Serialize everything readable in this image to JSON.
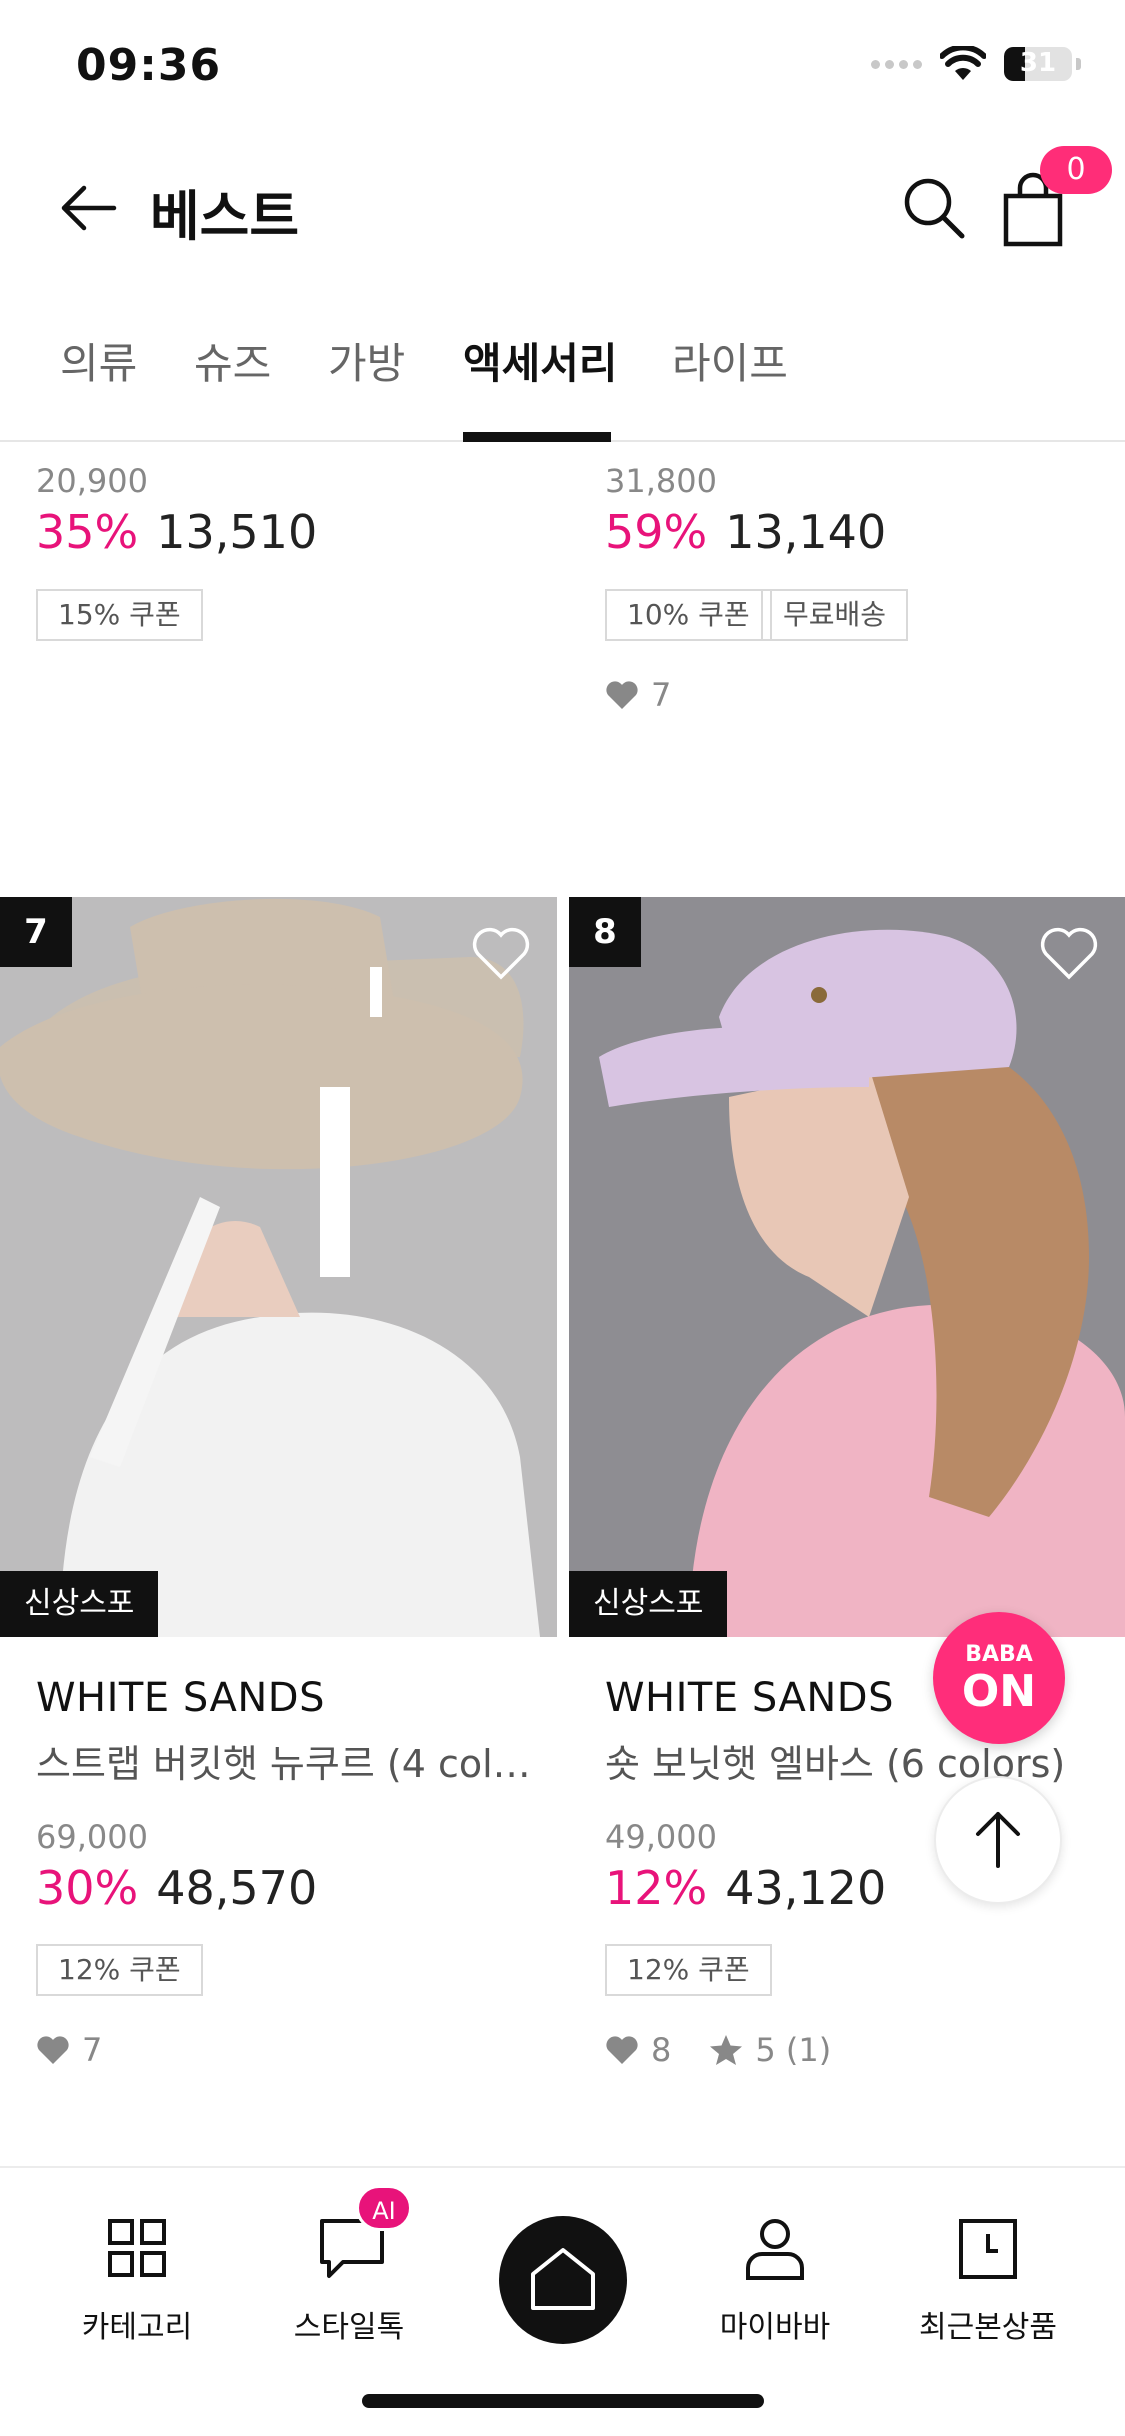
{
  "status_bar": {
    "time": "09:36",
    "battery": "31",
    "battery_level": 0.31
  },
  "header": {
    "title": "베스트",
    "cart_count": "0"
  },
  "tabs": [
    {
      "label": "의류",
      "active": false
    },
    {
      "label": "슈즈",
      "active": false
    },
    {
      "label": "가방",
      "active": false
    },
    {
      "label": "액세서리",
      "active": true
    },
    {
      "label": "라이프",
      "active": false
    }
  ],
  "prev_products": [
    {
      "original_price": "20,900",
      "discount": "35%",
      "price": "13,510",
      "chips": [
        "15% 쿠폰"
      ],
      "likes": null
    },
    {
      "original_price": "31,800",
      "discount": "59%",
      "price": "13,140",
      "chips": [
        "10% 쿠폰",
        "무료배송"
      ],
      "likes": "7"
    }
  ],
  "products": [
    {
      "rank": "7",
      "badge": "신상스포",
      "brand": "WHITE SANDS",
      "name": "스트랩 버킷햇 뉴쿠르 (4 color...",
      "original_price": "69,000",
      "discount": "30%",
      "price": "48,570",
      "chips": [
        "12% 쿠폰"
      ],
      "likes": "7",
      "rating": null,
      "image_colors": {
        "bg": "#bdbcbd",
        "hat": "#cdbfae",
        "shirt": "#f2f2f2",
        "skin": "#e9cdbf"
      }
    },
    {
      "rank": "8",
      "badge": "신상스포",
      "brand": "WHITE SANDS",
      "name": "숏 보닛햇 엘바스 (6 colors)",
      "original_price": "49,000",
      "discount": "12%",
      "price": "43,120",
      "chips": [
        "12% 쿠폰"
      ],
      "likes": "8",
      "rating": "5 (1)",
      "image_colors": {
        "bg": "#8e8d92",
        "hat": "#d8c4e2",
        "shirt": "#f0b4c4",
        "hair": "#b88a66",
        "skin": "#e8c7b6"
      }
    }
  ],
  "floating": {
    "baba_line1": "BABA",
    "baba_line2": "ON"
  },
  "bottom_nav": [
    {
      "label": "카테고리"
    },
    {
      "label": "스타일톡",
      "badge": "AI"
    },
    {
      "label": "홈"
    },
    {
      "label": "마이바바"
    },
    {
      "label": "최근본상품"
    }
  ],
  "colors": {
    "accent": "#e8137a",
    "badge_pink": "#ff2d78"
  }
}
